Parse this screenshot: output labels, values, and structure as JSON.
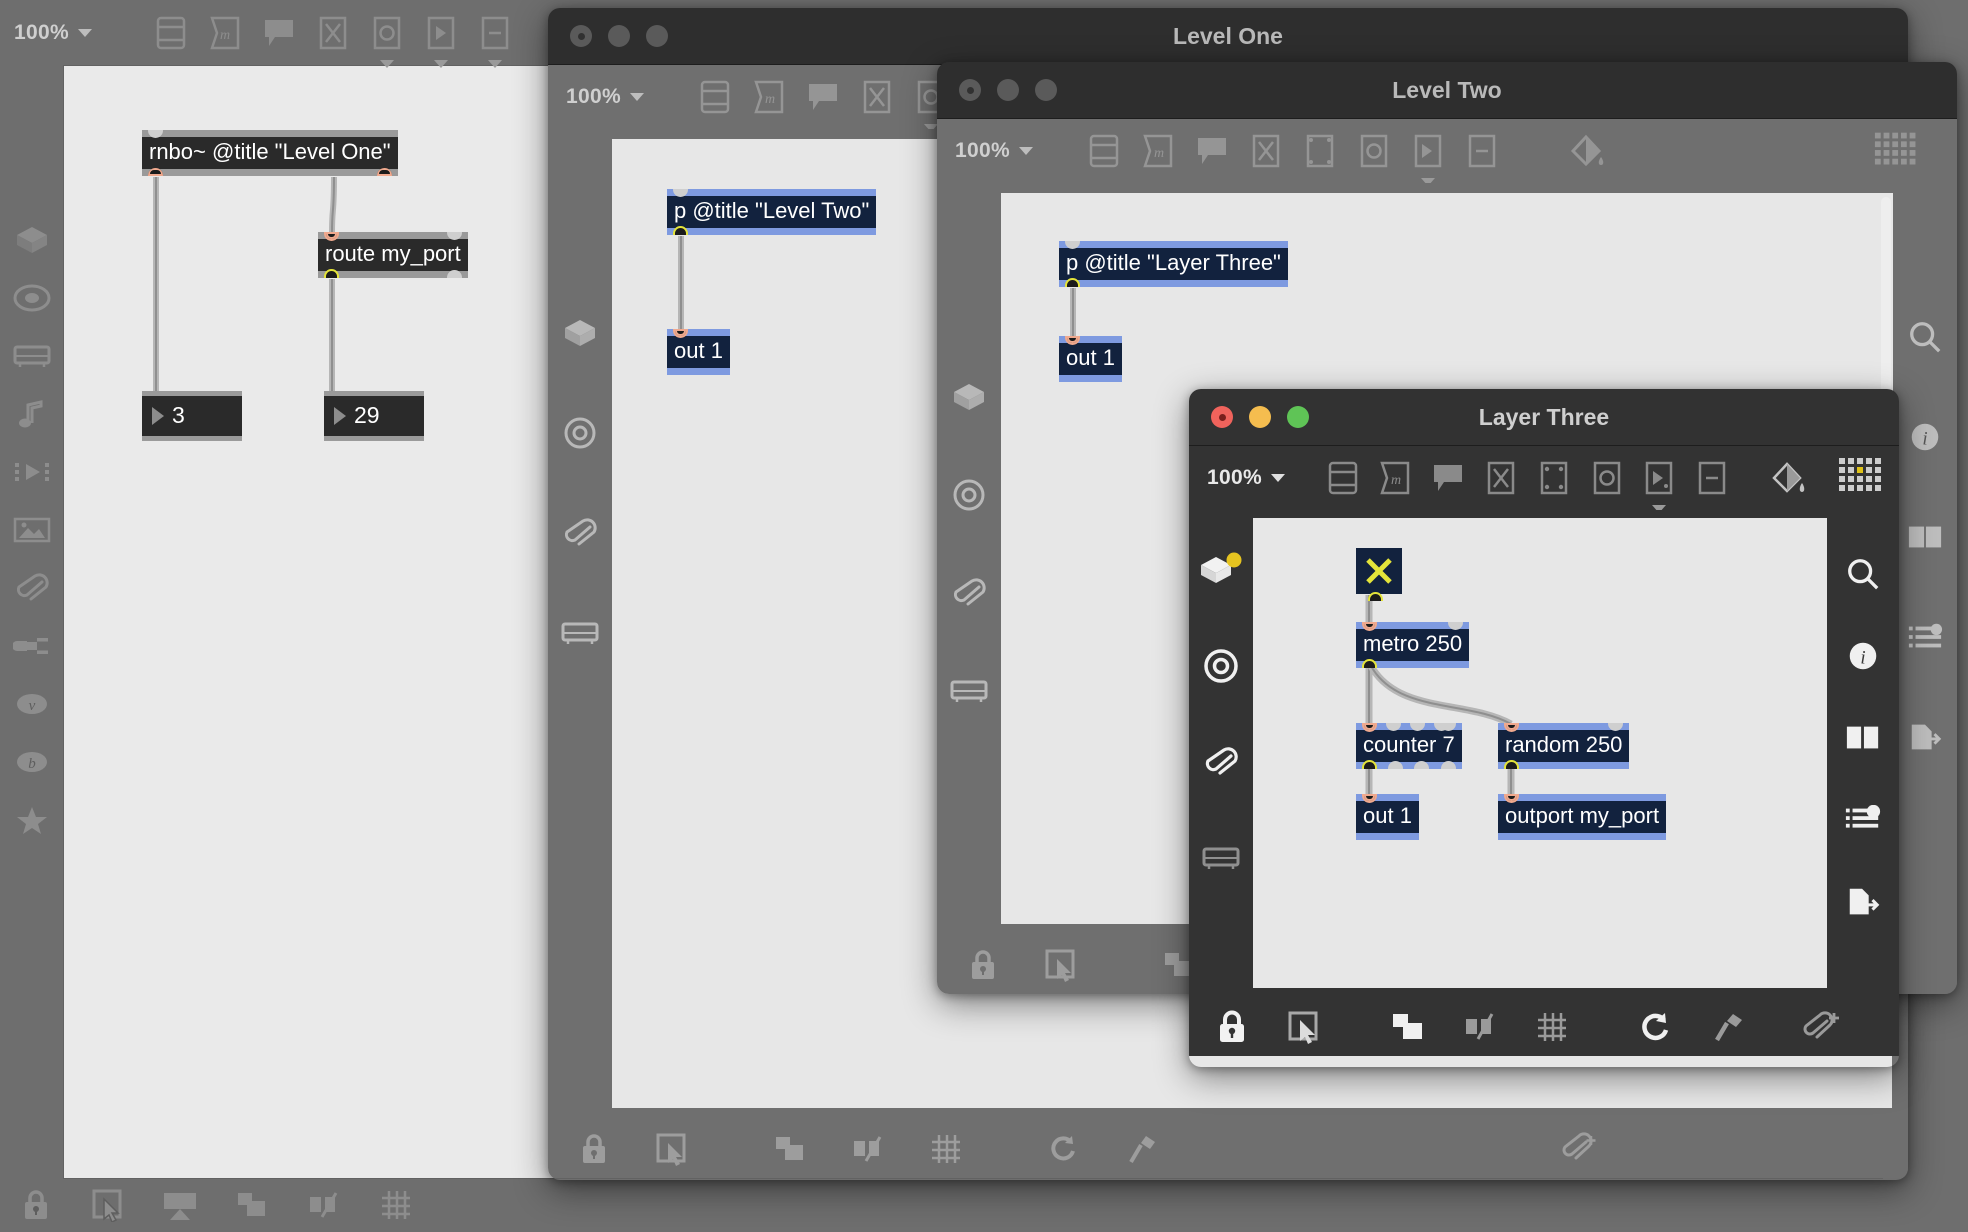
{
  "app": {
    "zoom_label": "100%",
    "top_toolbar_icons": [
      "inspector-icon",
      "message-icon",
      "comment-icon",
      "toggle-icon",
      "button-icon",
      "number-icon",
      "panel-icon"
    ],
    "left_rail_icons": [
      "object-explorer-icon",
      "circle-target-icon",
      "keyboard-icon",
      "music-note-icon",
      "video-icon",
      "image-icon",
      "paperclip-icon",
      "audio-plug-icon",
      "vizzie-icon",
      "beap-icon",
      "favorites-star-icon"
    ],
    "right_rail_icons": [
      "search-icon",
      "info-icon",
      "split-view-icon",
      "parameters-icon",
      "export-icon"
    ],
    "bottom_icons": [
      "lock-icon",
      "edit-cursor-icon",
      "presentation-icon",
      "arrange-icon",
      "snap-icon",
      "grid-icon"
    ],
    "power_icon": "power-icon",
    "transport_icon": "transport-icon"
  },
  "windows": [
    {
      "title": "Level One",
      "active": false,
      "zoom_label": "100%",
      "toolbar_icons": [
        "inspector-icon",
        "message-icon",
        "comment-icon",
        "toggle-icon",
        "button-icon",
        "number-icon",
        "panel-icon"
      ],
      "side_rail_icons": [
        "object-explorer-icon",
        "circle-target-icon",
        "paperclip-icon",
        "keyboard-icon"
      ],
      "bottom_icons": [
        "lock-icon",
        "edit-cursor-icon",
        "arrange-icon",
        "snap-icon",
        "grid-icon",
        "refresh-icon",
        "hammer-icon",
        "add-clipping-icon"
      ],
      "objects": [
        {
          "name": "patcher-object",
          "text": "p @title \"Level Two\""
        },
        {
          "name": "outlet-object",
          "text": "out 1"
        }
      ]
    },
    {
      "title": "Level Two",
      "active": false,
      "zoom_label": "100%",
      "toolbar_icons": [
        "inspector-icon",
        "message-icon",
        "comment-icon",
        "toggle-icon",
        "button-icon",
        "number-icon",
        "panel-icon",
        "paint-icon",
        "grid-palette-icon"
      ],
      "side_rail_icons": [
        "object-explorer-icon",
        "circle-target-icon",
        "paperclip-icon",
        "keyboard-icon"
      ],
      "bottom_icons": [
        "lock-icon",
        "edit-cursor-icon",
        "arrange-icon"
      ],
      "objects": [
        {
          "name": "patcher-object",
          "text": "p @title \"Layer Three\""
        },
        {
          "name": "outlet-object",
          "text": "out 1"
        }
      ]
    },
    {
      "title": "Layer Three",
      "active": true,
      "zoom_label": "100%",
      "toolbar_icons": [
        "inspector-icon",
        "message-icon",
        "comment-icon",
        "toggle-icon",
        "button-icon",
        "number-icon",
        "panel-icon",
        "paint-icon",
        "grid-palette-icon"
      ],
      "side_rail_icons": [
        "object-explorer-icon",
        "circle-target-icon",
        "paperclip-icon",
        "keyboard-icon"
      ],
      "right_rail_icons": [
        "search-icon",
        "info-icon",
        "split-view-icon",
        "parameters-icon",
        "export-icon"
      ],
      "bottom_icons": [
        "lock-icon",
        "edit-cursor-icon",
        "arrange-icon",
        "snap-icon",
        "grid-icon",
        "refresh-icon",
        "hammer-icon",
        "add-clipping-icon"
      ],
      "objects": [
        {
          "name": "toggle-object",
          "text": ""
        },
        {
          "name": "metro-object",
          "text": "metro 250"
        },
        {
          "name": "counter-object",
          "text": "counter 7"
        },
        {
          "name": "random-object",
          "text": "random 250"
        },
        {
          "name": "outlet-object",
          "text": "out 1"
        },
        {
          "name": "outport-object",
          "text": "outport my_port"
        }
      ]
    }
  ],
  "root_patch": {
    "objects": [
      {
        "name": "rnbo-object",
        "text": "rnbo~ @title \"Level One\""
      },
      {
        "name": "route-object",
        "text": "route my_port"
      }
    ],
    "number_boxes": [
      {
        "name": "number-box-left",
        "value": "3"
      },
      {
        "name": "number-box-right",
        "value": "29"
      }
    ]
  },
  "colors": {
    "box_fill": "#12223e",
    "box_border_active": "#7e9ae0",
    "box_border_inactive": "#9a9a9a",
    "canvas": "#e7e7e7",
    "chrome_active": "#333333",
    "chrome_inactive": "#6f6f6f",
    "toggle_x": "#e4e43a",
    "traffic_red": "#f0635c",
    "traffic_yellow": "#f5bd4f",
    "traffic_green": "#5fc456"
  }
}
